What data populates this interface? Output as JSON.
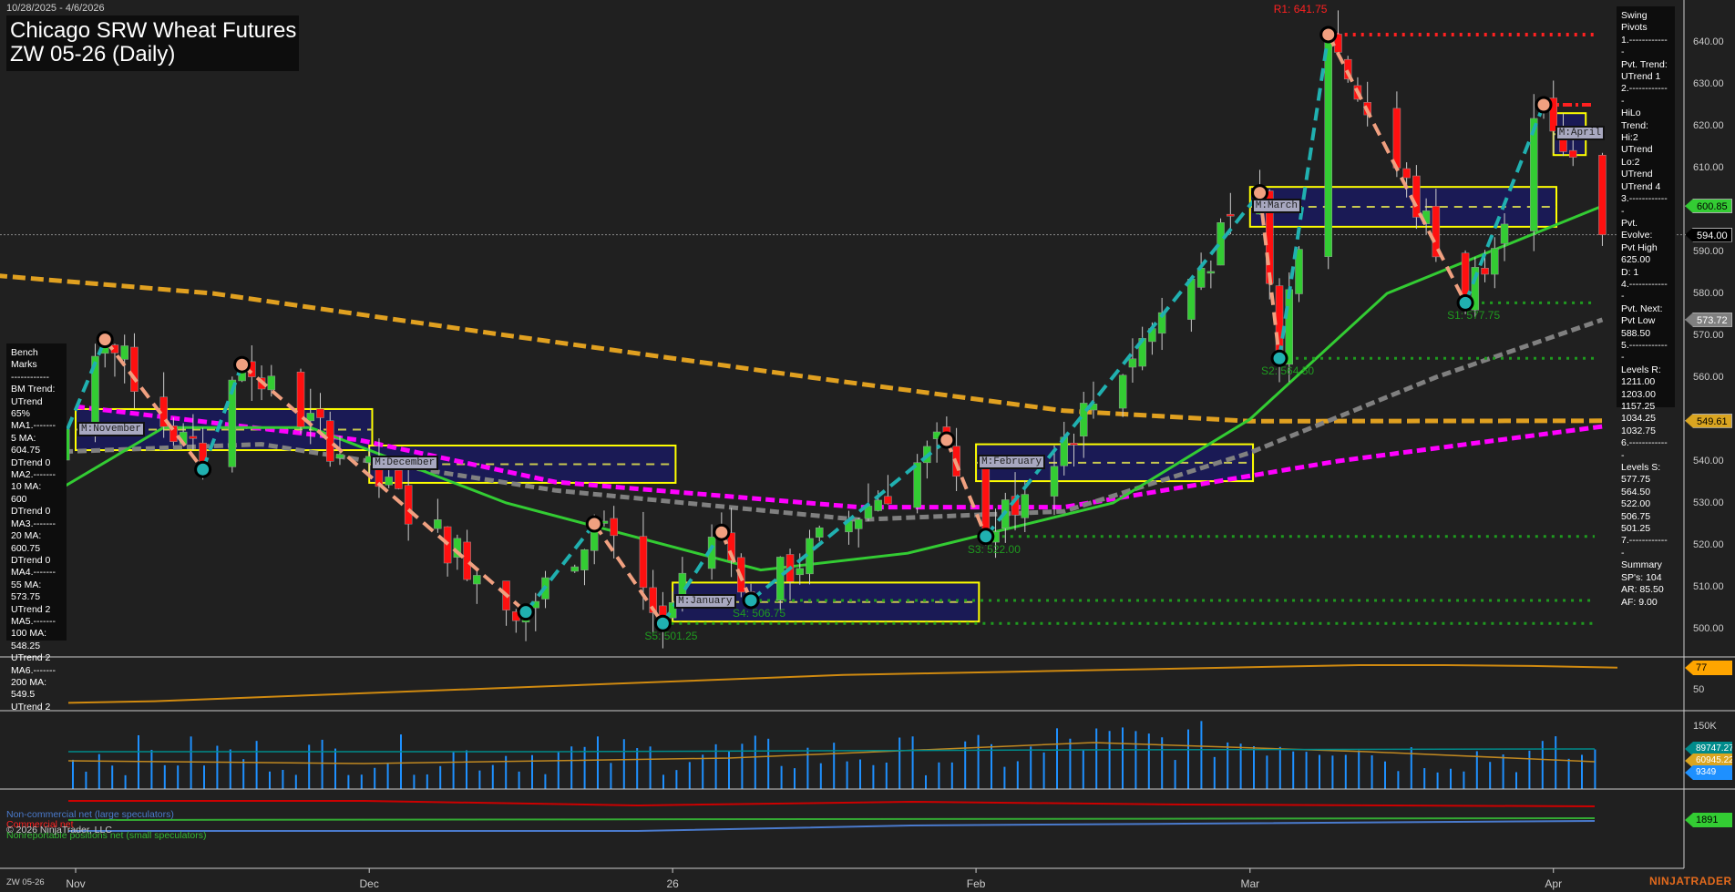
{
  "header": {
    "date_range": "10/28/2025 - 4/6/2026",
    "title": "Chicago SRW Wheat Futures",
    "subtitle": "ZW 05-26 (Daily)"
  },
  "bench_marks": [
    "Bench Marks",
    "------------",
    "BM Trend:",
    "UTrend 65%",
    "MA1.-------",
    "5 MA:",
    "604.75",
    "DTrend 0",
    "MA2.-------",
    "10 MA:",
    "600",
    "DTrend 0",
    "MA3.-------",
    "20 MA:",
    "600.75",
    "DTrend 0",
    "MA4.-------",
    "55 MA:",
    "573.75",
    "UTrend 2",
    "MA5.-------",
    "100 MA:",
    "548.25",
    "UTrend 2",
    "MA6.-------",
    "200 MA:",
    "549.5",
    "UTrend 2"
  ],
  "swing_pivots": [
    "Swing Pivots",
    "1.-------------",
    "Pvt. Trend:",
    "UTrend 1",
    "2.-------------",
    "HiLo Trend:",
    "Hi:2 UTrend",
    "Lo:2 UTrend",
    "UTrend 4",
    "3.-------------",
    "Pvt. Evolve:",
    "Pvt High",
    "625.00",
    "D: 1",
    "4.-------------",
    "Pvt. Next:",
    "Pvt Low",
    "588.50",
    "5.-------------",
    "Levels R:",
    "1211.00",
    "1203.00",
    "1157.25",
    "1034.25",
    "1032.75",
    "6.-------------",
    "Levels S:",
    "577.75",
    "564.50",
    "522.00",
    "506.75",
    "501.25",
    "7.-------------",
    "Summary",
    "SP's: 104",
    "AR: 85.50",
    "AF: 9.00"
  ],
  "chart_data": {
    "type": "candlestick",
    "title": "Chicago SRW Wheat Futures ZW 05-26 (Daily)",
    "ylim": [
      495,
      645
    ],
    "y_ticks": [
      "640.00",
      "630.00",
      "620.00",
      "610.00",
      "590.00",
      "580.00",
      "570.00",
      "560.00",
      "540.00",
      "530.00",
      "520.00",
      "510.00",
      "500.00"
    ],
    "y_tick_values": [
      640,
      630,
      620,
      610,
      590,
      580,
      570,
      560,
      540,
      530,
      520,
      510,
      500
    ],
    "x_ticks": [
      {
        "label": "Nov",
        "date": "2025-11-01"
      },
      {
        "label": "Dec",
        "date": "2025-12-01"
      },
      {
        "label": "26",
        "date": "2026-01-01"
      },
      {
        "label": "Feb",
        "date": "2026-02-01"
      },
      {
        "label": "Mar",
        "date": "2026-03-01"
      },
      {
        "label": "Apr",
        "date": "2026-04-01"
      }
    ],
    "swing_pivots_path": [
      {
        "date": "2025-10-28",
        "price": 530
      },
      {
        "date": "2025-11-04",
        "price": 569
      },
      {
        "date": "2025-11-14",
        "price": 538
      },
      {
        "date": "2025-11-18",
        "price": 563
      },
      {
        "date": "2025-12-17",
        "price": 504
      },
      {
        "date": "2025-12-24",
        "price": 525
      },
      {
        "date": "2025-12-31",
        "price": 501.25
      },
      {
        "date": "2026-01-06",
        "price": 523
      },
      {
        "date": "2026-01-09",
        "price": 506.75
      },
      {
        "date": "2026-01-29",
        "price": 545
      },
      {
        "date": "2026-02-02",
        "price": 522
      },
      {
        "date": "2026-03-02",
        "price": 604
      },
      {
        "date": "2026-03-04",
        "price": 564.5
      },
      {
        "date": "2026-03-09",
        "price": 641.75
      },
      {
        "date": "2026-03-23",
        "price": 577.75
      },
      {
        "date": "2026-03-31",
        "price": 625
      },
      {
        "date": "2026-04-06",
        "price": 594
      }
    ],
    "levels": [
      {
        "label": "R1: 641.75",
        "price": 641.75,
        "from": "2026-03-09",
        "color": "#ff2020",
        "kind": "resistance"
      },
      {
        "label": "S1: 577.75",
        "price": 577.75,
        "from": "2026-03-23",
        "color": "#1f9a1f",
        "kind": "support"
      },
      {
        "label": "S2: 564.50",
        "price": 564.5,
        "from": "2026-03-04",
        "color": "#1f9a1f",
        "kind": "support"
      },
      {
        "label": "S3: 522.00",
        "price": 522,
        "from": "2026-02-02",
        "color": "#1f9a1f",
        "kind": "support"
      },
      {
        "label": "S4: 506.75",
        "price": 506.75,
        "from": "2026-01-09",
        "color": "#1f9a1f",
        "kind": "support"
      },
      {
        "label": "S5: 501.25",
        "price": 501.25,
        "from": "2025-12-31",
        "color": "#1f9a1f",
        "kind": "support"
      }
    ],
    "month_boxes": [
      {
        "label": "M:November",
        "from": "2025-11-01",
        "to": "2025-11-30",
        "high": 552.4,
        "low": 542.6
      },
      {
        "label": "M:December",
        "from": "2025-12-01",
        "to": "2025-12-31",
        "high": 543.7,
        "low": 534.8
      },
      {
        "label": "M:January",
        "from": "2026-01-01",
        "to": "2026-01-31",
        "high": 511,
        "low": 501.7
      },
      {
        "label": "M:February",
        "from": "2026-02-01",
        "to": "2026-02-28",
        "high": 544,
        "low": 535.2
      },
      {
        "label": "M:March",
        "from": "2026-03-01",
        "to": "2026-03-31",
        "high": 605.4,
        "low": 595.9
      },
      {
        "label": "M:April",
        "from": "2026-04-01",
        "to": "2026-04-03",
        "high": 623,
        "low": 613
      }
    ],
    "moving_averages": [
      {
        "name": "200 MA",
        "color": "#e0a020",
        "points": [
          [
            "2025-10-20",
            585
          ],
          [
            "2025-11-15",
            580
          ],
          [
            "2025-12-15",
            570
          ],
          [
            "2026-01-15",
            560
          ],
          [
            "2026-02-10",
            552
          ],
          [
            "2026-03-01",
            549.5
          ],
          [
            "2026-04-06",
            549.61
          ]
        ]
      },
      {
        "name": "100 MA",
        "color": "#ff00ff",
        "points": [
          [
            "2025-11-01",
            553
          ],
          [
            "2025-11-30",
            545
          ],
          [
            "2025-12-20",
            535
          ],
          [
            "2026-01-20",
            529
          ],
          [
            "2026-02-10",
            529
          ],
          [
            "2026-03-10",
            540
          ],
          [
            "2026-04-06",
            548.25
          ]
        ]
      },
      {
        "name": "55 MA",
        "color": "#808080",
        "points": [
          [
            "2025-10-28",
            542
          ],
          [
            "2025-11-20",
            544
          ],
          [
            "2025-12-20",
            533
          ],
          [
            "2026-01-20",
            526
          ],
          [
            "2026-02-10",
            528
          ],
          [
            "2026-03-01",
            542
          ],
          [
            "2026-03-20",
            560
          ],
          [
            "2026-04-06",
            573.72
          ]
        ]
      },
      {
        "name": "20 MA",
        "color": "#33cc33",
        "points": [
          [
            "2025-10-28",
            530
          ],
          [
            "2025-11-10",
            548
          ],
          [
            "2025-11-25",
            548
          ],
          [
            "2025-12-15",
            530
          ],
          [
            "2026-01-10",
            514
          ],
          [
            "2026-01-25",
            518
          ],
          [
            "2026-02-15",
            530
          ],
          [
            "2026-03-01",
            550
          ],
          [
            "2026-03-15",
            580
          ],
          [
            "2026-04-06",
            600.85
          ]
        ]
      }
    ],
    "last_price": 594.0,
    "r_pending": 625.0
  },
  "price_tags": [
    {
      "value": "600.85",
      "price": 600.85,
      "bg": "#33cc33",
      "fg": "#000"
    },
    {
      "value": "594.00",
      "price": 594.0,
      "bg": "#000",
      "fg": "#fff"
    },
    {
      "value": "573.72",
      "price": 573.72,
      "bg": "#808080",
      "fg": "#fff"
    },
    {
      "value": "549.61",
      "price": 549.61,
      "bg": "#daa520",
      "fg": "#000"
    }
  ],
  "oscillator": {
    "value": "77",
    "tick": "50",
    "color": "#ffa500",
    "series": [
      34,
      36,
      40,
      44,
      48,
      52,
      56,
      60,
      64,
      68,
      70,
      72,
      74,
      76,
      78,
      80,
      80,
      79,
      77
    ]
  },
  "volume": {
    "tick": "150K",
    "tags": [
      {
        "value": "89747.27",
        "bg": "#008b8b",
        "y": -89747
      },
      {
        "value": "60945.22",
        "bg": "#daa520",
        "y": -60945
      },
      {
        "value": "9349",
        "bg": "#1e90ff",
        "y": -9349
      }
    ]
  },
  "cot": {
    "tag": "1891",
    "legend": [
      "Non-commercial net (large speculators)",
      "Commercial net",
      "Nonreportable positions net (small speculators)"
    ],
    "colors": [
      "#4a7acc",
      "#ff0000",
      "#33aa33"
    ]
  },
  "footer": {
    "copyright": "© 2026 NinjaTrader, LLC",
    "instrument": "ZW 05-26",
    "brand": "NINJATRADER"
  }
}
